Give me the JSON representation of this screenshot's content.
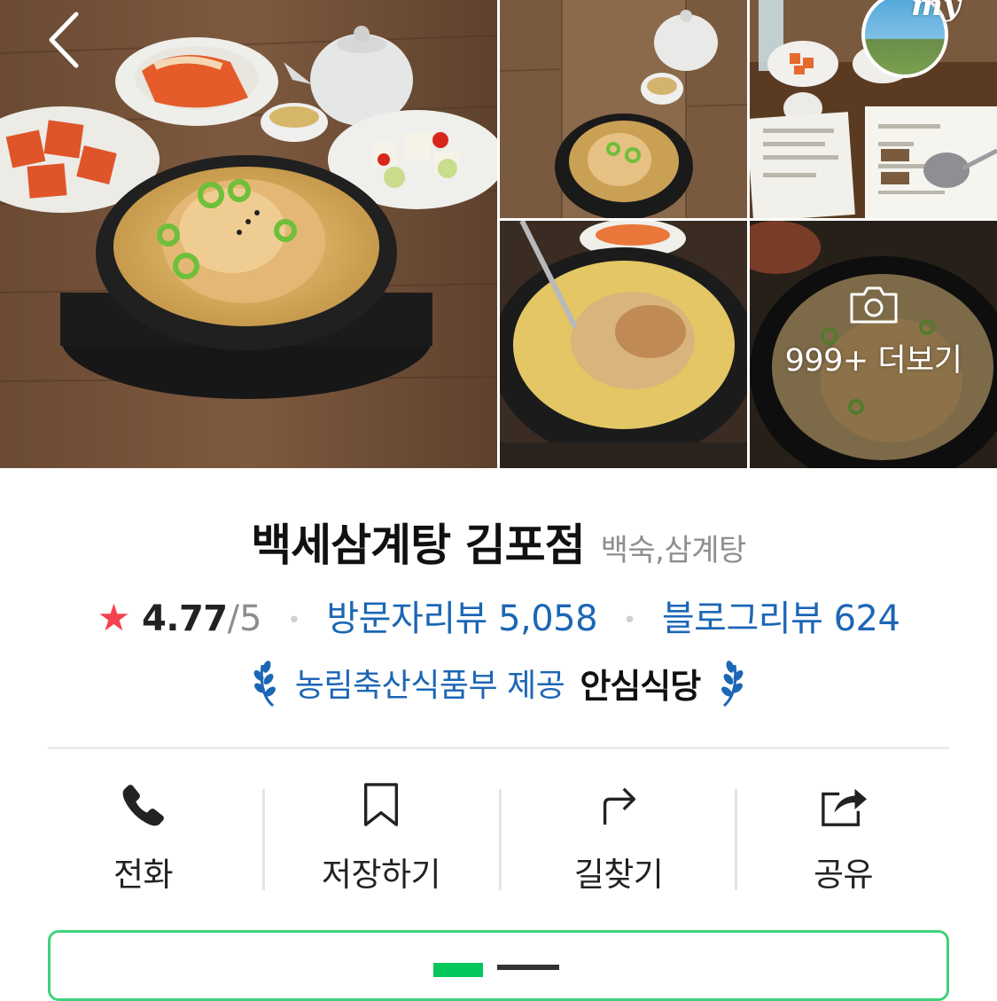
{
  "header": {
    "back_icon": "chevron-left-icon",
    "my_label": "my"
  },
  "gallery": {
    "more_icon": "camera-icon",
    "more_text": "999+ 더보기"
  },
  "place": {
    "name": "백세삼계탕 김포점",
    "category": "백숙,삼계탕"
  },
  "rating": {
    "star_icon": "star-icon",
    "score": "4.77",
    "score_max": "/5",
    "separator": "•",
    "visitor_review": "방문자리뷰 5,058",
    "blog_review": "블로그리뷰 624"
  },
  "badge": {
    "provider": "농림축산식품부 제공",
    "label": "안심식당"
  },
  "actions": [
    {
      "label": "전화",
      "icon": "phone-icon"
    },
    {
      "label": "저장하기",
      "icon": "bookmark-icon"
    },
    {
      "label": "길찾기",
      "icon": "directions-icon"
    },
    {
      "label": "공유",
      "icon": "share-icon"
    }
  ],
  "colors": {
    "link_blue": "#1c66b5",
    "star_red": "#f4414e",
    "naver_green": "#03c75a"
  }
}
